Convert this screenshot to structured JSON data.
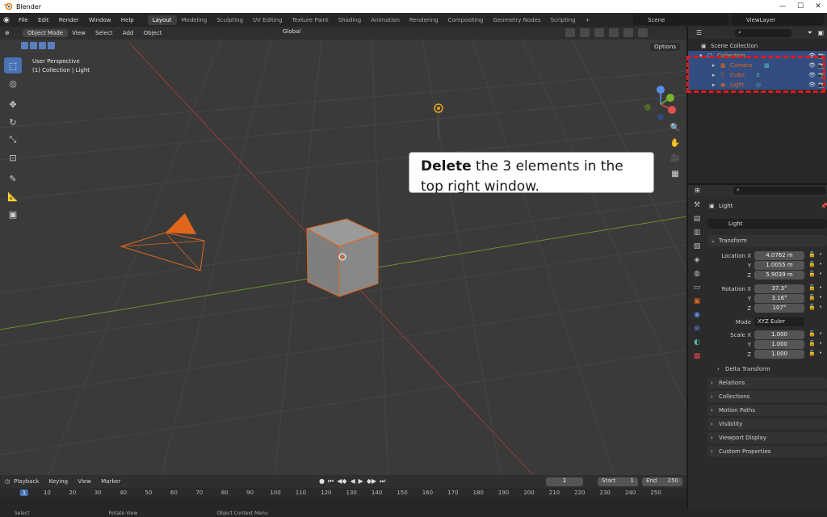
{
  "window": {
    "title": "Blender"
  },
  "menubar": {
    "menus": [
      "File",
      "Edit",
      "Render",
      "Window",
      "Help"
    ],
    "workspaces": [
      "Layout",
      "Modeling",
      "Sculpting",
      "UV Editing",
      "Texture Paint",
      "Shading",
      "Animation",
      "Rendering",
      "Compositing",
      "Geometry Nodes",
      "Scripting"
    ],
    "active_workspace": "Layout",
    "scene": "Scene",
    "view_layer": "ViewLayer"
  },
  "viewport": {
    "mode": "Object Mode",
    "menus": [
      "View",
      "Select",
      "Add",
      "Object"
    ],
    "orientation": "Global",
    "options_label": "Options",
    "info_line1": "User Perspective",
    "info_line2": "(1) Collection | Light"
  },
  "instruction": {
    "bold": "Delete",
    "rest": " the 3 elements in the top right window."
  },
  "outliner": {
    "search_placeholder": "",
    "scene_collection": "Scene Collection",
    "collection": "Collection",
    "items": [
      {
        "name": "Camera",
        "selected": true
      },
      {
        "name": "Cube",
        "selected": true
      },
      {
        "name": "Light",
        "selected": true
      }
    ]
  },
  "timeline": {
    "menus": [
      "Playback",
      "Keying",
      "View",
      "Marker"
    ],
    "current_frame": "1",
    "start_label": "Start",
    "start_value": "1",
    "end_label": "End",
    "end_value": "250",
    "ticks": [
      "1",
      "10",
      "20",
      "30",
      "40",
      "50",
      "60",
      "70",
      "80",
      "90",
      "100",
      "110",
      "120",
      "130",
      "140",
      "150",
      "160",
      "170",
      "180",
      "190",
      "200",
      "210",
      "220",
      "230",
      "240",
      "250"
    ]
  },
  "statusbar": {
    "items": [
      "Select",
      "Rotate View",
      "Object Context Menu"
    ]
  },
  "properties": {
    "object_name": "Light",
    "object_field": "Light",
    "transform_label": "Transform",
    "location_label": "Location X",
    "location": [
      "4.0762 m",
      "1.0055 m",
      "5.9039 m"
    ],
    "rotation_label": "Rotation X",
    "rotation": [
      "37.3°",
      "3.16°",
      "107°"
    ],
    "mode_label": "Mode",
    "mode_value": "XYZ Euler",
    "scale_label": "Scale X",
    "scale": [
      "1.000",
      "1.000",
      "1.000"
    ],
    "axis_y": "Y",
    "axis_z": "Z",
    "delta_transform": "Delta Transform",
    "sections": [
      "Relations",
      "Collections",
      "Motion Paths",
      "Visibility",
      "Viewport Display",
      "Custom Properties"
    ]
  }
}
